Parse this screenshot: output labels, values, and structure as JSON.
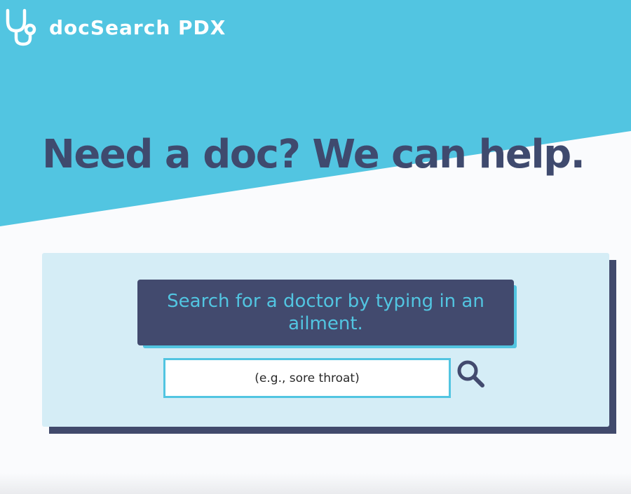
{
  "brand": {
    "name": "docSearch PDX",
    "logo_icon": "stethoscope-icon"
  },
  "hero": {
    "headline": "Need a doc? We can help."
  },
  "search": {
    "prompt": "Search for a doctor by typing in an ailment.",
    "placeholder": "(e.g., sore throat)",
    "button_icon": "magnifier-icon"
  },
  "colors": {
    "accent_cyan": "#52c5e1",
    "navy": "#424a6e",
    "card_bg": "#d5edf6",
    "page_bg": "#fafbfd"
  }
}
